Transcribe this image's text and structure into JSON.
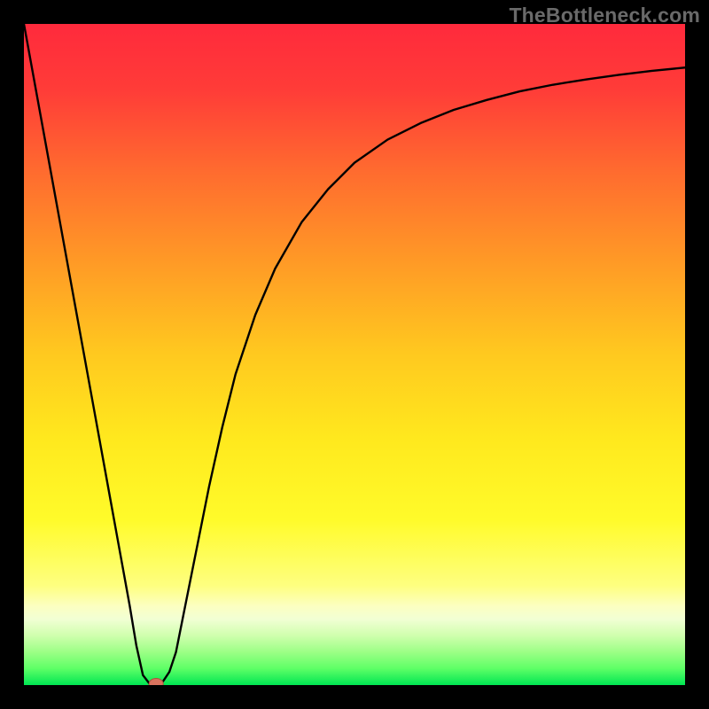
{
  "watermark": "TheBottleneck.com",
  "chart_data": {
    "type": "line",
    "title": "",
    "xlabel": "",
    "ylabel": "",
    "xlim": [
      0,
      100
    ],
    "ylim": [
      0,
      100
    ],
    "x": [
      0,
      2,
      4,
      6,
      8,
      10,
      12,
      14,
      16,
      17,
      18,
      19,
      20,
      21,
      22,
      23,
      24,
      26,
      28,
      30,
      32,
      35,
      38,
      42,
      46,
      50,
      55,
      60,
      65,
      70,
      75,
      80,
      85,
      90,
      95,
      100
    ],
    "values": [
      100,
      89,
      78,
      67,
      56,
      45,
      34,
      23,
      12,
      6,
      1.5,
      0.2,
      0.2,
      0.5,
      2,
      5,
      10,
      20,
      30,
      39,
      47,
      56,
      63,
      70,
      75,
      79,
      82.5,
      85,
      87,
      88.5,
      89.8,
      90.8,
      91.6,
      92.3,
      92.9,
      93.4
    ],
    "marker": {
      "x": 20,
      "y": 0.2
    },
    "background_bands": [
      {
        "from": 100,
        "to": 82,
        "color_top": "#ff2c3a",
        "color_bottom": "#ff5d32"
      },
      {
        "from": 82,
        "to": 60,
        "color_top": "#ff5d32",
        "color_bottom": "#ffa129"
      },
      {
        "from": 60,
        "to": 40,
        "color_top": "#ffa129",
        "color_bottom": "#ffd822"
      },
      {
        "from": 40,
        "to": 25,
        "color_top": "#ffd822",
        "color_bottom": "#fff41e"
      },
      {
        "from": 25,
        "to": 12,
        "color_top": "#fff41e",
        "color_bottom": "#feff60"
      },
      {
        "from": 12,
        "to": 6,
        "color_top": "#feffb0",
        "color_bottom": "#d8ff9a"
      },
      {
        "from": 6,
        "to": 3,
        "color_top": "#b4ff8a",
        "color_bottom": "#7aff6a"
      },
      {
        "from": 3,
        "to": 0,
        "color_top": "#4cff55",
        "color_bottom": "#00e851"
      }
    ]
  }
}
